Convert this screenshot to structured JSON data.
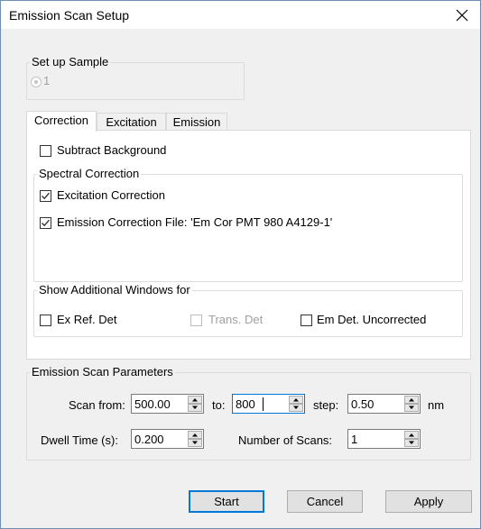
{
  "window": {
    "title": "Emission Scan Setup"
  },
  "setup_sample": {
    "legend": "Set up Sample",
    "radio_label": "1"
  },
  "tabs": [
    {
      "label": "Correction",
      "active": true
    },
    {
      "label": "Excitation",
      "active": false
    },
    {
      "label": "Emission",
      "active": false
    }
  ],
  "correction": {
    "subtract_background": {
      "label": "Subtract Background",
      "checked": false
    },
    "spectral_legend": "Spectral Correction",
    "excitation_correction": {
      "label": "Excitation Correction",
      "checked": true
    },
    "emission_correction": {
      "label": "Emission Correction File: 'Em Cor PMT 980 A4129-1'",
      "checked": true
    },
    "additional_legend": "Show Additional Windows for",
    "ex_ref_det": {
      "label": "Ex Ref. Det",
      "checked": false
    },
    "trans_det": {
      "label": "Trans. Det",
      "checked": false,
      "disabled": true
    },
    "em_det_uncorrected": {
      "label": "Em Det. Uncorrected",
      "checked": false
    }
  },
  "scan_params": {
    "legend": "Emission Scan Parameters",
    "scan_from_label": "Scan from:",
    "scan_from_value": "500.00",
    "to_label": "to:",
    "to_value": "800",
    "step_label": "step:",
    "step_value": "0.50",
    "unit": "nm",
    "dwell_label": "Dwell Time (s):",
    "dwell_value": "0.200",
    "num_scans_label": "Number of Scans:",
    "num_scans_value": "1"
  },
  "buttons": {
    "start": "Start",
    "cancel": "Cancel",
    "apply": "Apply"
  },
  "colors": {
    "accent": "#0078d7",
    "window_border": "#6d8fb3",
    "dialog_bg": "#f0f0f0"
  }
}
